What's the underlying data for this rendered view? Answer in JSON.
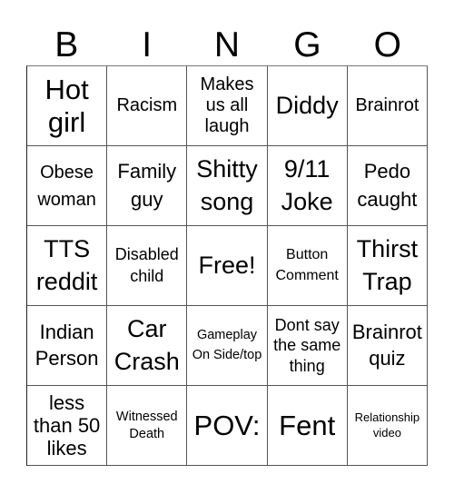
{
  "header": {
    "letters": [
      "B",
      "I",
      "N",
      "G",
      "O"
    ]
  },
  "grid": {
    "rows": [
      [
        "Hot girl",
        "Racism",
        "Makes us all laugh",
        "Diddy",
        "Brainrot"
      ],
      [
        "Obese woman",
        "Family guy",
        "Shitty song",
        "9/11 Joke",
        "Pedo caught"
      ],
      [
        "TTS reddit",
        "Disabled child",
        "Free!",
        "Button Comment",
        "Thirst Trap"
      ],
      [
        "Indian Person",
        "Car Crash",
        "Gameplay On Side/top",
        "Dont say the same thing",
        "Brainrot quiz"
      ],
      [
        "less than 50 likes",
        "Witnessed Death",
        "POV:",
        "Fent",
        "Relationship video"
      ]
    ],
    "free_space": "Free!"
  }
}
